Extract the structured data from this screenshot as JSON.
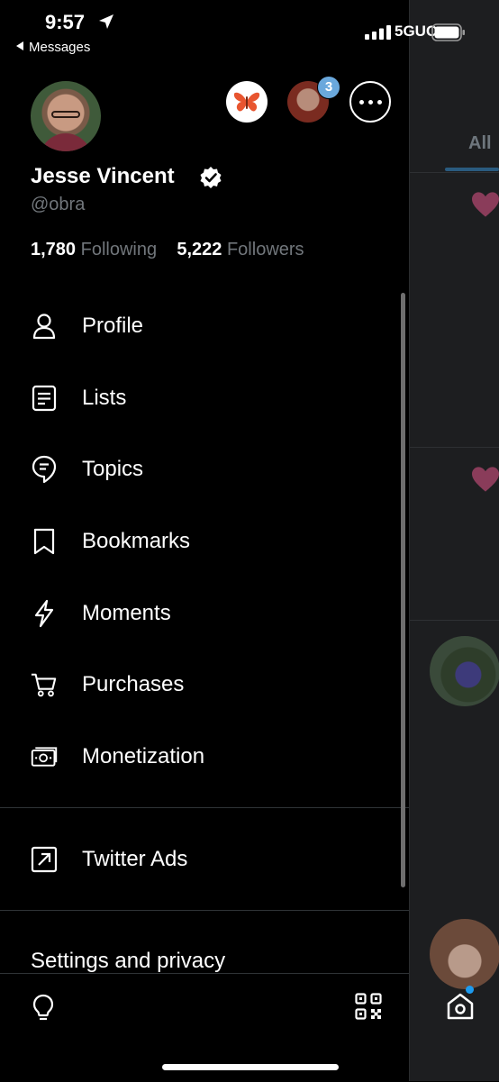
{
  "status_bar": {
    "time": "9:57",
    "back_app": "Messages",
    "network": "5GUC"
  },
  "profile": {
    "name": "Jesse Vincent",
    "handle": "@obra",
    "following_count": "1,780",
    "following_label": "Following",
    "followers_count": "5,222",
    "followers_label": "Followers",
    "account_badge": "3"
  },
  "menu": [
    {
      "label": "Profile",
      "icon": "person-icon"
    },
    {
      "label": "Lists",
      "icon": "list-icon"
    },
    {
      "label": "Topics",
      "icon": "topic-icon"
    },
    {
      "label": "Bookmarks",
      "icon": "bookmark-icon"
    },
    {
      "label": "Moments",
      "icon": "lightning-icon"
    },
    {
      "label": "Purchases",
      "icon": "cart-icon"
    },
    {
      "label": "Monetization",
      "icon": "money-icon"
    }
  ],
  "ads": {
    "label": "Twitter Ads",
    "icon": "external-link-icon"
  },
  "settings_label": "Settings and privacy",
  "background": {
    "tab_label": "All"
  },
  "colors": {
    "background": "#000000",
    "muted_text": "#71767b",
    "accent": "#1d9bf0",
    "butterfly": "#e8552f"
  }
}
